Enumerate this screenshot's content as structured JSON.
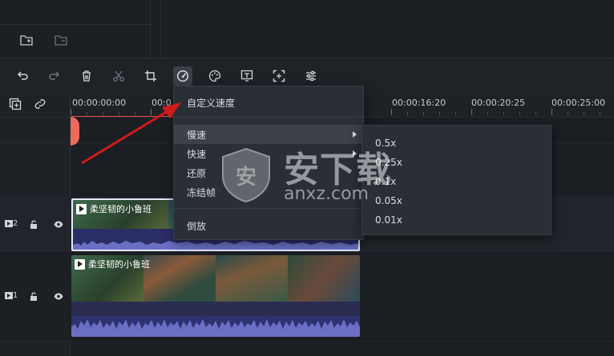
{
  "toolbar": {
    "buttons": [
      "undo-icon",
      "redo-icon",
      "delete-icon",
      "cut-icon",
      "crop-icon",
      "speed-icon",
      "color-icon",
      "text-icon",
      "focus-icon",
      "adjust-icon"
    ]
  },
  "ruler": {
    "ticks": [
      "00:00:00:00",
      "00:0",
      "00:00:16:20",
      "00:00:20:25",
      "00:00:25:00"
    ]
  },
  "tracks": [
    {
      "index": "2",
      "clip_title": "柔坚韧的小鲁班"
    },
    {
      "index": "1",
      "clip_title": "柔坚韧的小鲁班"
    }
  ],
  "context_menu": {
    "items": [
      "自定义速度",
      "慢速",
      "快速",
      "还原",
      "冻结帧",
      "倒放"
    ]
  },
  "submenu": {
    "items": [
      "0.5x",
      "0.25x",
      "0.1x",
      "0.05x",
      "0.01x"
    ]
  },
  "watermark": {
    "text": "安下载",
    "sub": "anxz.com",
    "badge": "安"
  },
  "colors": {
    "accent": "#e74c3c",
    "audio": "#2f3270",
    "menu_bg": "#2a2e35"
  }
}
